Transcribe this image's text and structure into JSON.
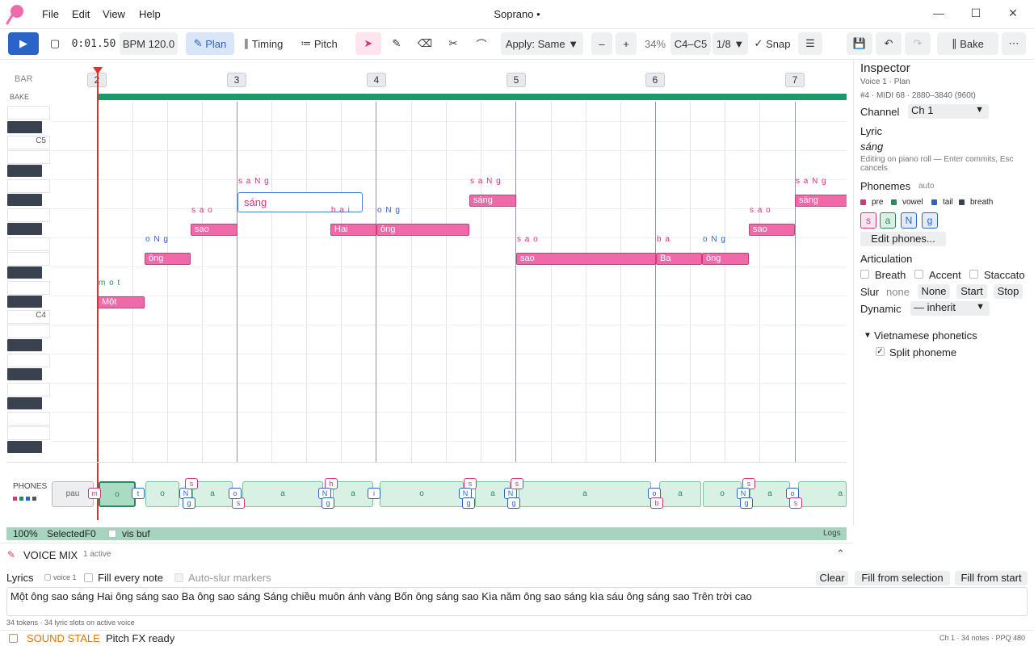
{
  "app": {
    "title": "Soprano •"
  },
  "menu": {
    "file": "File",
    "edit": "Edit",
    "view": "View",
    "help": "Help"
  },
  "toolbar": {
    "time": "0:01.50",
    "bpm": "BPM 120.0",
    "plan": "Plan",
    "timing": "Timing",
    "pitch": "Pitch",
    "apply": "Apply: Same",
    "minus": "–",
    "plus": "+",
    "zoom": "34%",
    "range": "C4–C5",
    "quant": "1/8",
    "snap": "Snap",
    "bake": "Bake"
  },
  "ruler": {
    "label": "BAR",
    "bake_label": "BAKE",
    "bars": [
      "2",
      "3",
      "4",
      "5",
      "6",
      "7"
    ]
  },
  "keys": {
    "c5": "C5",
    "c4": "C4"
  },
  "notes": [
    {
      "lyric": "Một",
      "phones": "m o t"
    },
    {
      "lyric": "ông",
      "phones": "o N g"
    },
    {
      "lyric": "sao",
      "phones": "s a o"
    },
    {
      "lyric": "sáng",
      "phones": "s a N g"
    },
    {
      "lyric": "Hai",
      "phones": "h a i"
    },
    {
      "lyric": "ông",
      "phones": "o N g"
    },
    {
      "lyric": "sáng",
      "phones": "s a N g"
    },
    {
      "lyric": "sao",
      "phones": "s a o"
    },
    {
      "lyric": "Ba",
      "phones": "b a"
    },
    {
      "lyric": "ông",
      "phones": "o N g"
    },
    {
      "lyric": "sao",
      "phones": "s a o"
    },
    {
      "lyric": "sáng",
      "phones": "s a N g"
    }
  ],
  "editor": {
    "value": "sáng"
  },
  "phones_panel": {
    "label": "PHONES",
    "segments": [
      "pau",
      "o",
      "o",
      "a",
      "o",
      "a",
      "a",
      "o",
      "a",
      "a",
      "a",
      "o",
      "a",
      "a",
      "o",
      "a",
      "a"
    ],
    "markers": [
      "m",
      "t",
      "N",
      "g",
      "s",
      "s",
      "o",
      "s",
      "h",
      "N",
      "g",
      "i",
      "s",
      "N",
      "g",
      "N",
      "g",
      "s",
      "o",
      "b",
      "s",
      "N",
      "g",
      "o",
      "s"
    ]
  },
  "status": {
    "pct": "100%",
    "selected": "SelectedF0",
    "visbuf": "vis buf",
    "logs": "Logs"
  },
  "inspector": {
    "title": "Inspector",
    "sub1": "Voice 1 · Plan",
    "sub2": "#4 · MIDI 68 · 2880–3840 (960t)",
    "channel_label": "Channel",
    "channel_value": "Ch 1",
    "lyric_label": "Lyric",
    "lyric_value": "sáng",
    "lyric_hint": "Editing on piano roll — Enter commits, Esc cancels",
    "phonemes_label": "Phonemes",
    "phonemes_auto": "auto",
    "legend": [
      "pre",
      "vowel",
      "tail",
      "breath"
    ],
    "chips": [
      "s",
      "a",
      "N",
      "g"
    ],
    "edit_phones": "Edit phones...",
    "articulation": "Articulation",
    "breath": "Breath",
    "accent": "Accent",
    "staccato": "Staccato",
    "slur": "Slur",
    "slur_value": "none",
    "slur_none": "None",
    "slur_start": "Start",
    "slur_stop": "Stop",
    "dynamic": "Dynamic",
    "dynamic_value": "— inherit",
    "viet": "Vietnamese phonetics",
    "split": "Split phoneme"
  },
  "voicemix": {
    "label": "VOICE MIX",
    "active": "1 active"
  },
  "lyrics": {
    "label": "Lyrics",
    "voice": "voice 1",
    "fill_every": "Fill every note",
    "auto_slur": "Auto-slur markers",
    "clear": "Clear",
    "fill_sel": "Fill from selection",
    "fill_start": "Fill from start",
    "text": "Một ông sao sáng Hai ông sáng sao Ba ông sao sáng Sáng chiều muôn ánh vàng Bốn ông sáng sao Kìa năm ông sao sáng kìa sáu ông sáng sao Trên trời cao",
    "count": "34 tokens · 34 lyric slots on active voice"
  },
  "bottom": {
    "stale": "SOUND STALE",
    "fx": "Pitch FX ready",
    "right": "Ch 1 · 34 notes · PPQ 480"
  },
  "colors": {
    "accent": "#2a64c8",
    "note": "#f06aaa",
    "playhead": "#e03030",
    "vowel": "#2b8a5a"
  }
}
